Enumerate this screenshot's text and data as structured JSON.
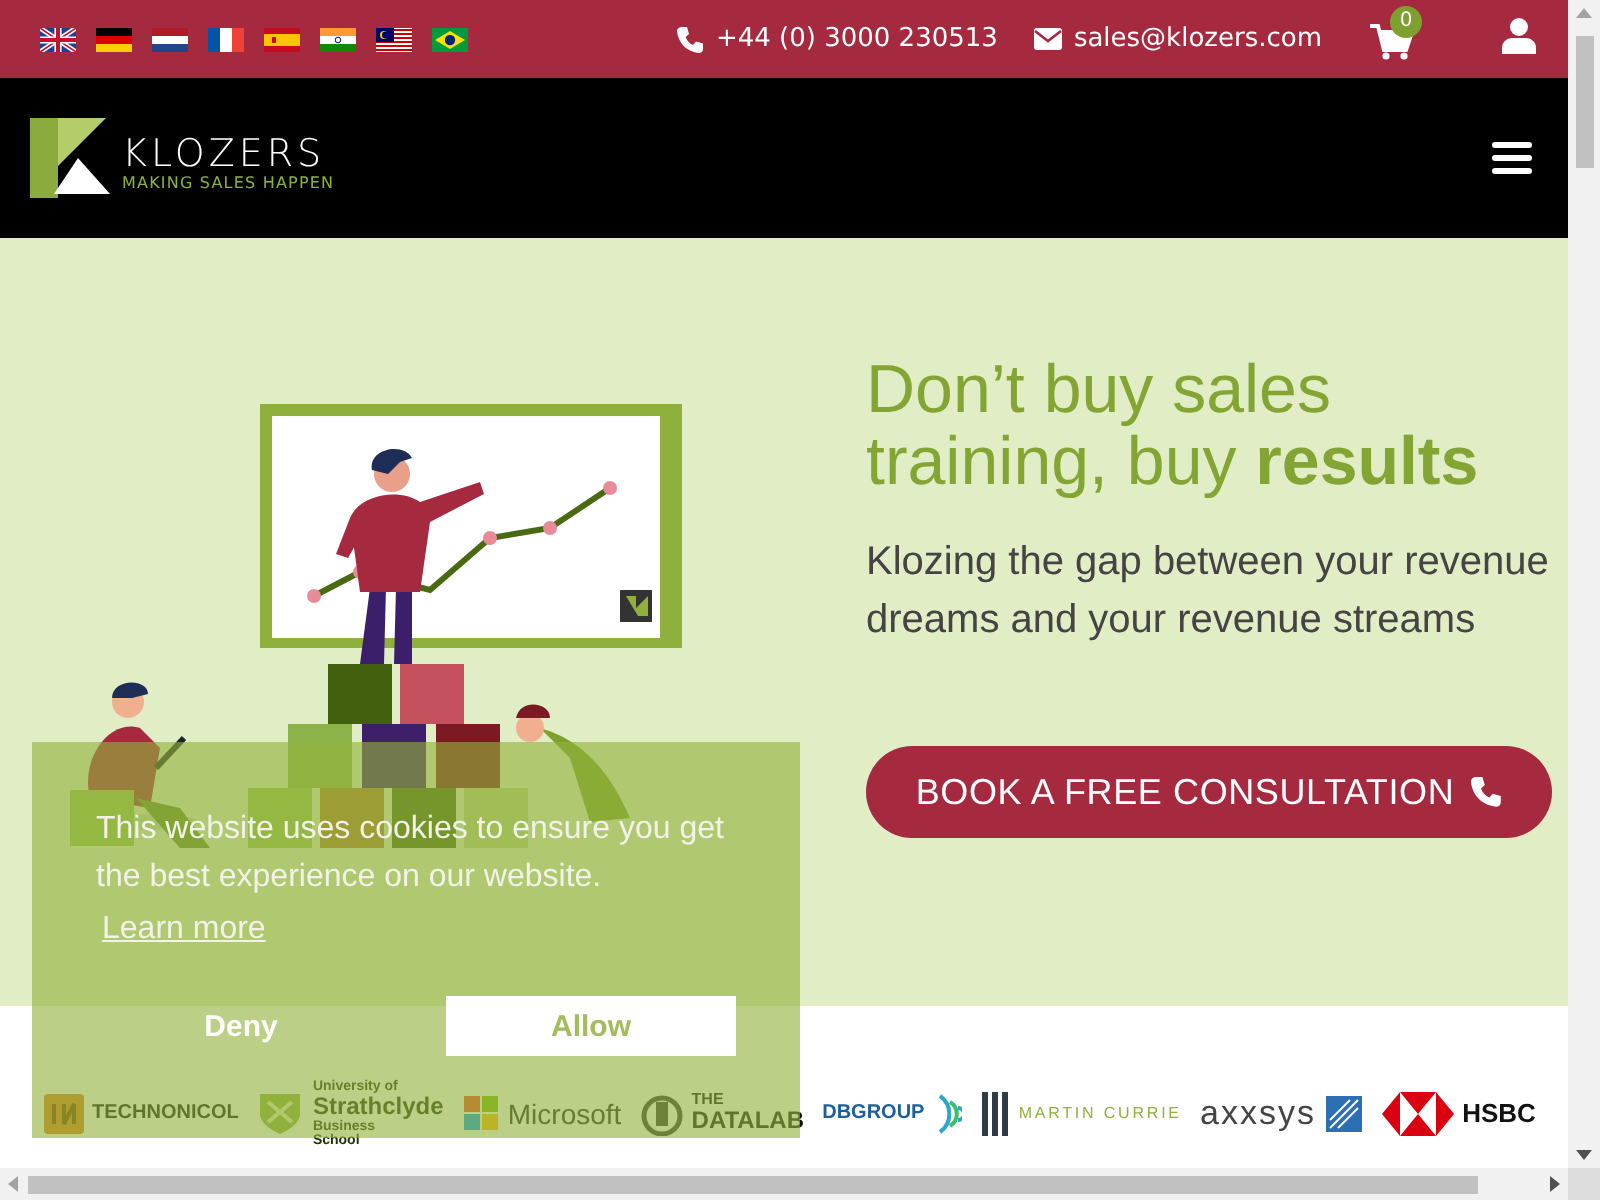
{
  "topbar": {
    "phone": "+44 (0) 3000 230513",
    "email": "sales@klozers.com",
    "cart_count": "0"
  },
  "header": {
    "brand": "KLOZERS",
    "tagline": "MAKING SALES HAPPEN"
  },
  "hero": {
    "heading": "Don’t buy sales training, buy **results**",
    "subheading": "Klozing the gap between your revenue dreams and your revenue streams",
    "button": "BOOK A FREE CONSULTATION"
  },
  "client_logos": [
    {
      "kind": "square-mark",
      "lines": [
        "TECHNONICOL"
      ]
    },
    {
      "kind": "crest",
      "lines": [
        "University of",
        "Strathclyde",
        "Business",
        "School"
      ]
    },
    {
      "kind": "grid-mark",
      "lines": [
        "Microsoft"
      ]
    },
    {
      "kind": "flask-mark",
      "lines": [
        "THE",
        "DATALAB"
      ]
    },
    {
      "kind": "rings-mark",
      "lines": [
        "DBGROUP"
      ]
    },
    {
      "kind": "bars-mark",
      "lines": [
        "MARTIN CURRIE"
      ]
    },
    {
      "kind": "tile-mark",
      "lines": [
        "axxsys"
      ]
    },
    {
      "kind": "hexagon-mark",
      "lines": [
        "HSBC"
      ]
    }
  ],
  "cookie_banner": {
    "message": "This website uses cookies to ensure you get the best experience on our website.",
    "link": "Learn more",
    "buttons": [
      {
        "label": "Deny",
        "kind": "deny"
      },
      {
        "label": "Allow",
        "kind": "allow"
      }
    ]
  }
}
